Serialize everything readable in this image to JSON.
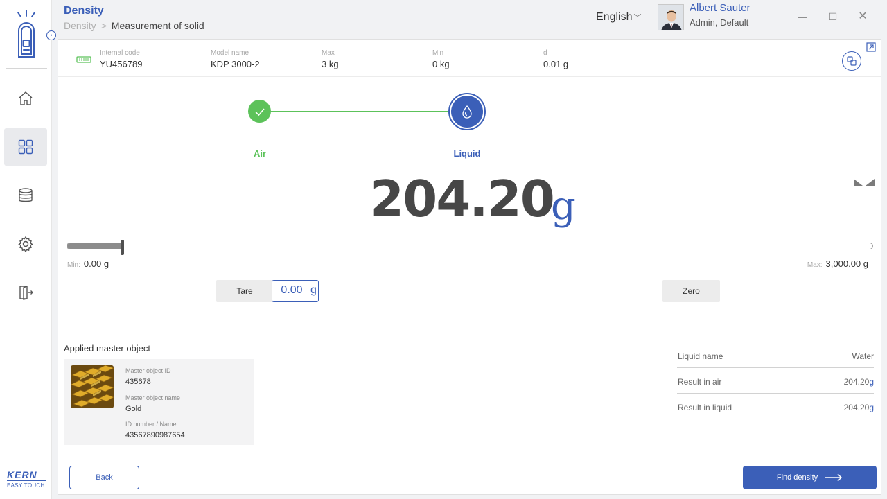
{
  "header": {
    "title": "Density",
    "breadcrumb": [
      "Density",
      "Measurement of solid"
    ],
    "language": "English",
    "user_name": "Albert Sauter",
    "user_role": "Admin, Default"
  },
  "sidebar": {
    "items": [
      {
        "icon": "home-icon"
      },
      {
        "icon": "apps-icon",
        "active": true
      },
      {
        "icon": "database-icon"
      },
      {
        "icon": "settings-icon"
      },
      {
        "icon": "logout-icon"
      }
    ],
    "brand": "KERN",
    "brand_sub": "EASY TOUCH"
  },
  "device": {
    "fields": [
      {
        "label": "Internal code",
        "value": "YU456789"
      },
      {
        "label": "Model name",
        "value": "KDP 3000-2"
      },
      {
        "label": "Max",
        "value": "3 kg"
      },
      {
        "label": "Min",
        "value": "0 kg"
      },
      {
        "label": "d",
        "value": "0.01 g"
      }
    ]
  },
  "steps": {
    "air_label": "Air",
    "liquid_label": "Liquid"
  },
  "weight": {
    "value": "204.20",
    "unit": "g",
    "min_label": "Min:",
    "min_value": "0.00 g",
    "max_label": "Max:",
    "max_value": "3,000.00 g",
    "progress": 0.068
  },
  "tare": {
    "button": "Tare",
    "value": "0.00",
    "unit": "g",
    "zero_button": "Zero"
  },
  "master_object": {
    "title": "Applied master object",
    "fields": [
      {
        "label": "Master object ID",
        "value": "435678"
      },
      {
        "label": "Master object name",
        "value": "Gold"
      },
      {
        "label": "ID number / Name",
        "value": "43567890987654"
      }
    ]
  },
  "results": [
    {
      "label": "Liquid name",
      "value": "Water",
      "unit": ""
    },
    {
      "label": "Result in air",
      "value": "204.20",
      "unit": "g"
    },
    {
      "label": "Result in liquid",
      "value": "204.20",
      "unit": "g"
    }
  ],
  "footer": {
    "back": "Back",
    "find": "Find density"
  },
  "colors": {
    "accent": "#3b5fb8",
    "success": "#5cc25a",
    "text": "#333333"
  }
}
